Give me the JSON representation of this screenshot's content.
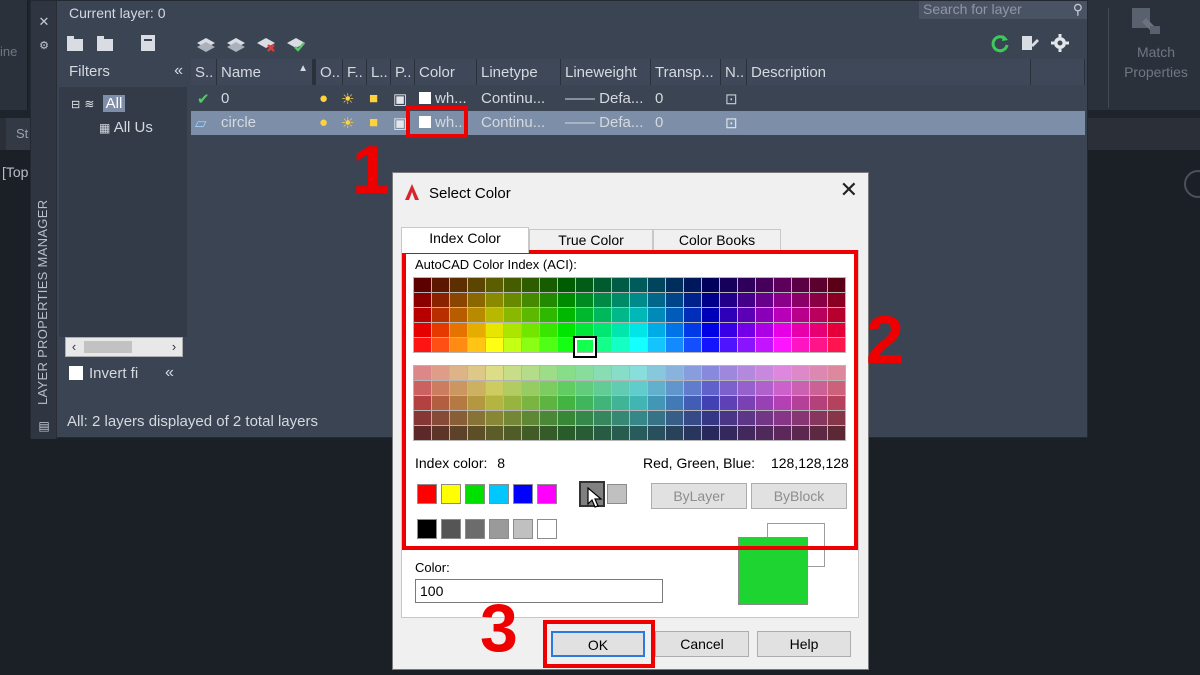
{
  "ribbon": {
    "left_partial_text": "ine",
    "match_properties_label": "Match Properties"
  },
  "document": {
    "tab_label": "St",
    "viewport_label": "[Top"
  },
  "palette": {
    "title": "LAYER PROPERTIES MANAGER",
    "current_layer": "Current layer: 0",
    "search_placeholder": "Search for layer",
    "filters_label": "Filters",
    "filter_tree": {
      "all": "All",
      "all_used": "All Us"
    },
    "invert_filter": "Invert fi",
    "status": "All: 2 layers displayed of 2 total layers",
    "columns": [
      "S..",
      "Name",
      "O..",
      "F..",
      "L..",
      "P..",
      "Color",
      "Linetype",
      "Lineweight",
      "Transp...",
      "N..",
      "Description"
    ],
    "layers": [
      {
        "name": "0",
        "color": "wh...",
        "linetype": "Continu...",
        "lineweight": "Defa...",
        "transparency": "0",
        "selected": false
      },
      {
        "name": "circle",
        "color": "wh...",
        "linetype": "Continu...",
        "lineweight": "Defa...",
        "transparency": "0",
        "selected": true
      }
    ]
  },
  "dialog": {
    "title": "Select Color",
    "tabs": [
      "Index Color",
      "True Color",
      "Color Books"
    ],
    "active_tab": "Index Color",
    "aci_label": "AutoCAD Color Index (ACI):",
    "index_color_label": "Index color:",
    "index_color_value": "8",
    "rgb_label": "Red, Green, Blue:",
    "rgb_value": "128,128,128",
    "bylayer_label": "ByLayer",
    "byblock_label": "ByBlock",
    "color_label": "Color:",
    "color_value": "100",
    "ok_label": "OK",
    "cancel_label": "Cancel",
    "help_label": "Help",
    "standard_colors": [
      "#ff0000",
      "#ffff00",
      "#00e000",
      "#00c8ff",
      "#0000ff",
      "#ff00ff"
    ],
    "gray_colors": [
      "#000000",
      "#555555",
      "#6c6c6c",
      "#9a9a9a",
      "#c0c0c0",
      "#ffffff"
    ],
    "selected_color_hex": "#1ed431"
  },
  "annotations": {
    "step1": "1",
    "step2": "2",
    "step3": "3",
    "color": "#ee0000"
  }
}
